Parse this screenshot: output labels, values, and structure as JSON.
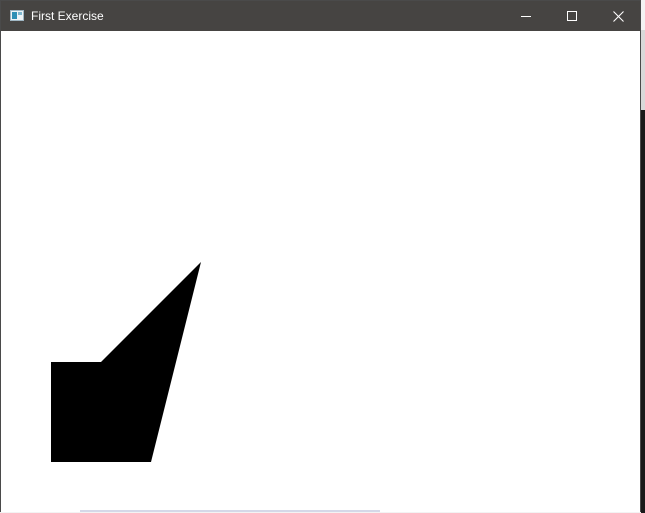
{
  "window": {
    "title": "First Exercise",
    "icon": "app-window-icon",
    "controls": {
      "minimize_icon": "minimize-icon",
      "maximize_icon": "maximize-icon",
      "close_icon": "close-icon"
    }
  },
  "canvas": {
    "background": "#ffffff",
    "shape": {
      "kind": "filled-polygon",
      "fill": "#000000"
    }
  },
  "colors": {
    "titlebar": "#464442",
    "title_text": "#ffffff"
  }
}
